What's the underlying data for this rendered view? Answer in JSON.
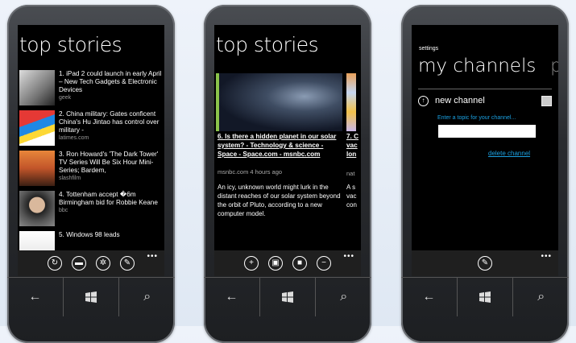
{
  "phone1": {
    "title": "top stories",
    "stories": [
      {
        "title": "1. iPad 2 could launch in early April – New Tech Gadgets & Electronic Devices",
        "source": "geek"
      },
      {
        "title": "2. China military: Gates conficent China's Hu Jintao has control over military -",
        "source": "latimes.com"
      },
      {
        "title": "3. Ron Howard's 'The Dark Tower' TV Series Will Be Six Hour Mini-Series; Bardem,",
        "source": "slashfilm"
      },
      {
        "title": "4. Tottenham accept �6m Birmingham bid for Robbie Keane",
        "source": "bbc"
      },
      {
        "title": "5. Windows 98 leads",
        "source": ""
      }
    ],
    "appbar_more": "•••"
  },
  "phone2": {
    "title": "top stories",
    "feature_title": "6. Is there a hidden planet in our solar system? - Technology & science - Space - Space.com - msnbc.com",
    "feature_source": "msnbc.com  4 hours ago",
    "feature_body": "An icy, unknown world might lurk in the distant reaches of our solar system beyond the orbit of Pluto, according to a new computer model.",
    "peek_title": "7. C\nvac\nlon",
    "peek_source": "nat",
    "peek_body": "A s\nvac\ncon",
    "appbar_more": "•••"
  },
  "phone3": {
    "settings_label": "settings",
    "title": "my channels",
    "title_peek": "pr",
    "new_channel_label": "new channel",
    "topic_hint": "Enter a topic for your channel...",
    "topic_value": "",
    "delete_label": "delete channel",
    "appbar_more": "•••"
  },
  "navbar": {
    "back_icon": "←",
    "start_icon": "windows-logo",
    "search_icon": "⌕"
  },
  "colors": {
    "accent": "#1ba1e2",
    "screen_bg": "#000000"
  }
}
